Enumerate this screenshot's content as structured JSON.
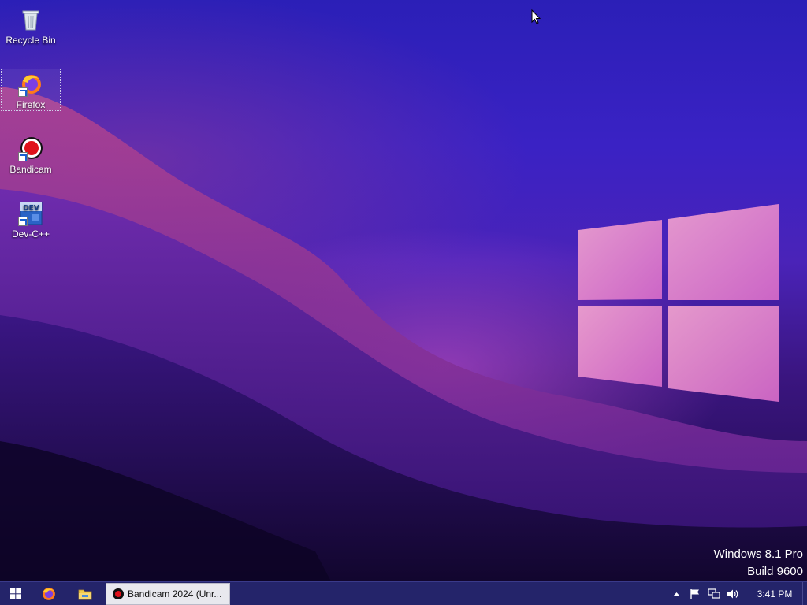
{
  "desktop": {
    "icons": [
      {
        "label": "Recycle Bin",
        "icon": "recycle-bin-icon"
      },
      {
        "label": "Firefox",
        "icon": "firefox-icon"
      },
      {
        "label": "Bandicam",
        "icon": "bandicam-icon"
      },
      {
        "label": "Dev-C++",
        "icon": "dev-cpp-icon"
      }
    ],
    "selected_icon": "Firefox"
  },
  "watermark": {
    "line1": "Windows 8.1 Pro",
    "line2": "Build 9600"
  },
  "taskbar": {
    "start_icon": "windows-logo-icon",
    "pinned": [
      {
        "name": "firefox",
        "icon": "firefox-icon"
      },
      {
        "name": "file-explorer",
        "icon": "folder-icon"
      }
    ],
    "active_task": {
      "label": "Bandicam 2024 (Unr...",
      "icon": "bandicam-record-icon"
    },
    "tray": {
      "icons": [
        "show-hidden-icons-chevron",
        "action-center-flag-icon",
        "network-icon",
        "volume-icon"
      ],
      "time": "3:41 PM"
    }
  },
  "colors": {
    "taskbar_bg": "#24246a",
    "wallpaper_top": "#2b1fb7",
    "wallpaper_glow": "#d65adc",
    "logo_pink": "#e88ad0"
  }
}
